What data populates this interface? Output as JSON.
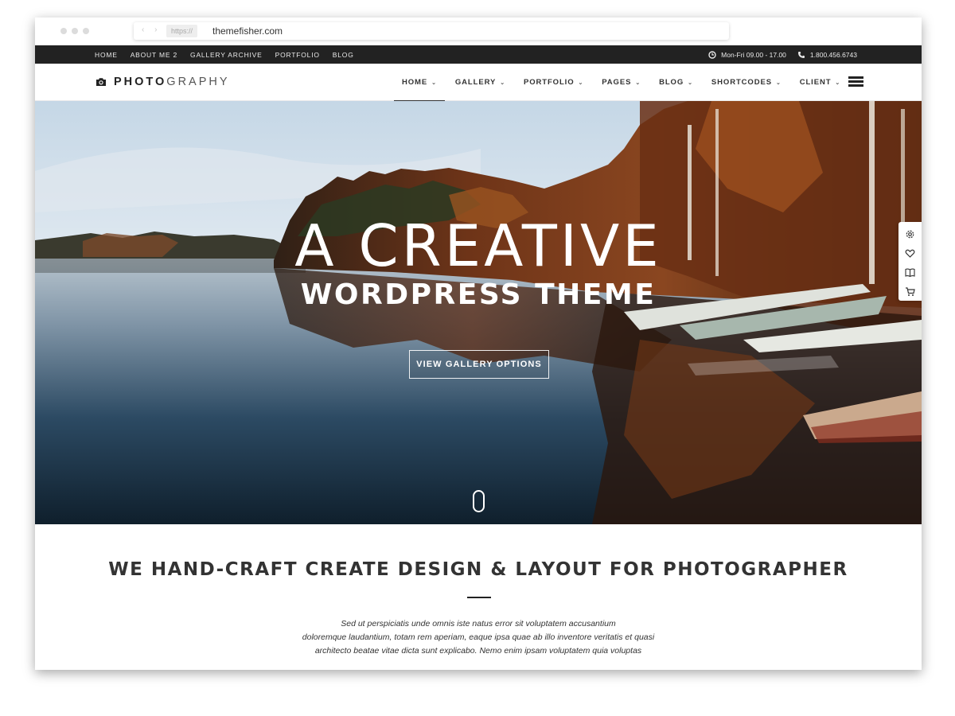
{
  "browser": {
    "protocol": "https://",
    "url": "themefisher.com"
  },
  "topbar": {
    "nav": [
      "HOME",
      "ABOUT ME 2",
      "GALLERY ARCHIVE",
      "PORTFOLIO",
      "BLOG"
    ],
    "hours": "Mon-Fri 09.00 - 17.00",
    "phone": "1.800.456.6743"
  },
  "header": {
    "logo_bold": "PHOTO",
    "logo_light": "GRAPHY",
    "nav": [
      "HOME",
      "GALLERY",
      "PORTFOLIO",
      "PAGES",
      "BLOG",
      "SHORTCODES",
      "CLIENT"
    ],
    "active_item": "HOME"
  },
  "hero": {
    "title": "A CREATIVE",
    "subtitle": "WORDPRESS THEME",
    "button": "VIEW GALLERY OPTIONS"
  },
  "side_tools": [
    "gear-icon",
    "heart-icon",
    "book-icon",
    "cart-icon"
  ],
  "section": {
    "title": "WE HAND-CRAFT CREATE DESIGN & LAYOUT FOR PHOTOGRAPHER",
    "text_lines": [
      "Sed ut perspiciatis unde omnis iste natus error sit voluptatem accusantium",
      "doloremque laudantium, totam rem aperiam, eaque ipsa quae ab illo inventore veritatis et quasi",
      "architecto beatae vitae dicta sunt explicabo. Nemo enim ipsam voluptatem quia voluptas"
    ]
  },
  "colors": {
    "topbar_bg": "#222222",
    "text_dark": "#333333",
    "tool_bg": "#2a2e35"
  }
}
